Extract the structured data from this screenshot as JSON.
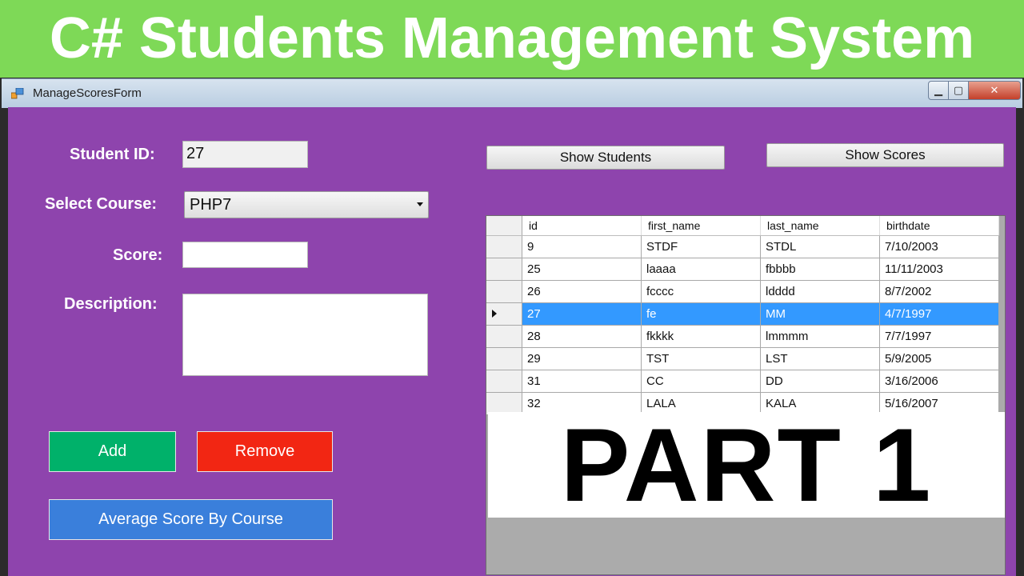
{
  "banner": {
    "title": "C# Students Management System"
  },
  "window": {
    "title": "ManageScoresForm",
    "buttons": {
      "minimize": "▁",
      "maximize": "▢",
      "close": "✕"
    }
  },
  "form": {
    "student_id_label": "Student ID:",
    "student_id_value": "27",
    "course_label": "Select Course:",
    "course_value": "PHP7",
    "score_label": "Score:",
    "score_value": "",
    "description_label": "Description:",
    "description_value": "",
    "add_label": "Add",
    "remove_label": "Remove",
    "average_label": "Average Score By Course",
    "show_students_label": "Show Students",
    "show_scores_label": "Show Scores"
  },
  "grid": {
    "columns": [
      "id",
      "first_name",
      "last_name",
      "birthdate"
    ],
    "rows": [
      [
        "9",
        "STDF",
        "STDL",
        "7/10/2003"
      ],
      [
        "25",
        "laaaa",
        "fbbbb",
        "11/11/2003"
      ],
      [
        "26",
        "fcccc",
        "ldddd",
        "8/7/2002"
      ],
      [
        "27",
        "fe",
        "MM",
        "4/7/1997"
      ],
      [
        "28",
        "fkkkk",
        "lmmmm",
        "7/7/1997"
      ],
      [
        "29",
        "TST",
        "LST",
        "5/9/2005"
      ],
      [
        "31",
        "CC",
        "DD",
        "3/16/2006"
      ],
      [
        "32",
        "LALA",
        "KALA",
        "5/16/2007"
      ]
    ],
    "selected_index": 3
  },
  "overlay": {
    "text": "PART 1"
  },
  "colors": {
    "banner": "#7ED957",
    "form_bg": "#8E44AD",
    "add": "#00B16A",
    "remove": "#F22613",
    "average": "#3A7FDB",
    "selection": "#3399FF"
  }
}
